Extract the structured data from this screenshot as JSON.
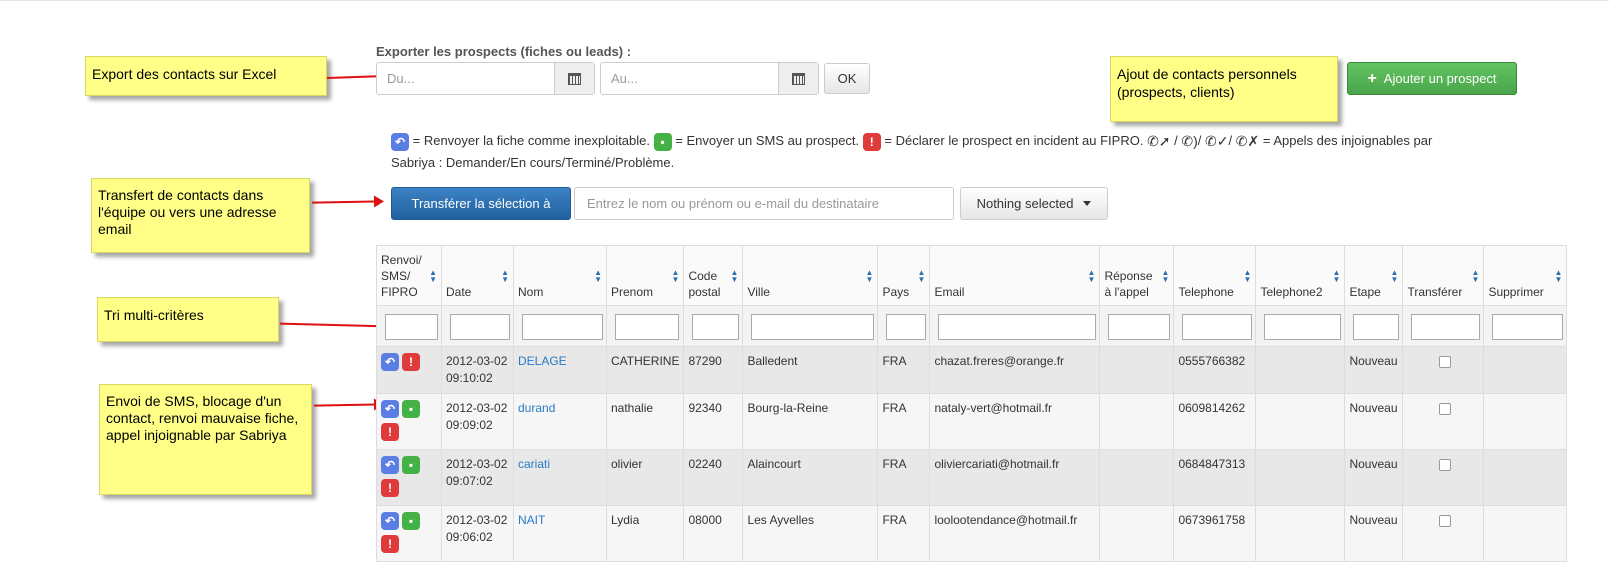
{
  "notes": {
    "export": "Export des contacts sur Excel",
    "add": "Ajout de contacts personnels (prospects, clients)",
    "transfer": "Transfert de contacts dans l'équipe ou vers une adresse email",
    "sort": "Tri multi-critères",
    "actions": "Envoi de SMS, blocage d'un contact, renvoi mauvaise fiche, appel injoignable par Sabriya"
  },
  "export": {
    "label": "Exporter les prospects (fiches ou leads) :",
    "from_placeholder": "Du...",
    "to_placeholder": "Au...",
    "ok_label": "OK"
  },
  "add_button": "Ajouter un prospect",
  "legend": {
    "t1": "= Renvoyer la fiche comme inexploitable.",
    "t2": "= Envoyer un SMS au prospect.",
    "t3": "= Déclarer le prospect en incident au FIPRO.",
    "t4": "= Appels des injoignables par Sabriya : Demander/En cours/Terminé/Problème."
  },
  "transfer": {
    "button": "Transférer la sélection à",
    "placeholder": "Entrez le nom ou prénom ou e-mail du destinataire",
    "dropdown": "Nothing selected"
  },
  "table": {
    "headers": [
      "Renvoi/ SMS/ FIPRO",
      "Date",
      "Nom",
      "Prenom",
      "Code postal",
      "Ville",
      "Pays",
      "Email",
      "Réponse à l'appel",
      "Telephone",
      "Telephone2",
      "Etape",
      "Transférer",
      "Supprimer"
    ],
    "rows": [
      {
        "date": "2012-03-02 09:10:02",
        "nom": "DELAGE",
        "prenom": "CATHERINE",
        "cp": "87290",
        "ville": "Balledent",
        "pays": "FRA",
        "email": "chazat.freres@orange.fr",
        "tel": "0555766382",
        "etape": "Nouveau"
      },
      {
        "date": "2012-03-02 09:09:02",
        "nom": "durand",
        "prenom": "nathalie",
        "cp": "92340",
        "ville": "Bourg-la-Reine",
        "pays": "FRA",
        "email": "nataly-vert@hotmail.fr",
        "tel": "0609814262",
        "etape": "Nouveau"
      },
      {
        "date": "2012-03-02 09:07:02",
        "nom": "cariati",
        "prenom": "olivier",
        "cp": "02240",
        "ville": "Alaincourt",
        "pays": "FRA",
        "email": "oliviercariati@hotmail.fr",
        "tel": "0684847313",
        "etape": "Nouveau"
      },
      {
        "date": "2012-03-02 09:06:02",
        "nom": "NAIT",
        "prenom": "Lydia",
        "cp": "08000",
        "ville": "Les Ayvelles",
        "pays": "FRA",
        "email": "loolootendance@hotmail.fr",
        "tel": "0673961758",
        "etape": "Nouveau"
      }
    ]
  }
}
